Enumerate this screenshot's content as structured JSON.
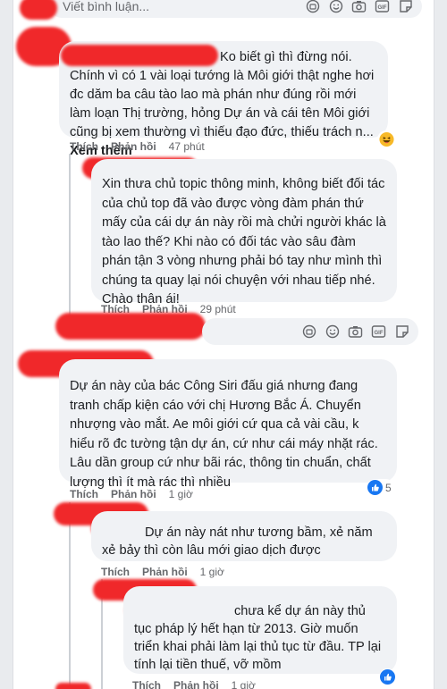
{
  "input_bar": {
    "placeholder": "Viết bình luận..."
  },
  "comments": [
    {
      "text": "Ko biết gì thì đừng nói. Chính vì có 1 vài loại tướng là Môi giới thật nghe hơi đc dăm ba câu tào lao mà phán như đúng rồi mới làm loạn Thị trường, hỏng Dự án và cái tên Môi giới cũng bị xem thường vì thiếu đạo đức, thiếu trách n... ",
      "see_more": "Xem thêm",
      "like": "Thích",
      "reply": "Phản hồi",
      "time": "47 phút",
      "reaction": "haha"
    },
    {
      "text": "Xin thưa chủ topic thông minh, không biết đối tác của chủ top đã vào được vòng đàm phán thứ mấy của cái dự án này rồi mà chửi người khác là tào lao thế? Khi nào có đối tác vào sâu đàm phán tận 3 vòng nhưng phải bó tay như mình thì chúng ta quay lại nói chuyện với nhau tiếp nhé. Chào thân ái!",
      "like": "Thích",
      "reply": "Phản hồi",
      "time": "29 phút"
    },
    {
      "text": "Dự án này của bác Công Siri đấu giá nhưng đang tranh chấp kiện cáo với chị Hương Bắc Á. Chuyển nhượng vào mắt. Ae môi giới cứ qua cả vài cầu, k hiểu rõ đc tường tận dự án, cứ như cái máy nhặt rác. Lâu dần group cứ như bãi rác, thông tin chuẩn, chất lượng thì ít mà rác thì nhiều",
      "like": "Thích",
      "reply": "Phản hồi",
      "time": "1 giờ",
      "reaction": "like",
      "reaction_count": "5"
    },
    {
      "text": "Dự án này nát như tương bầm, xẻ năm xẻ bảy thì còn lâu mới giao dịch được",
      "like": "Thích",
      "reply": "Phản hồi",
      "time": "1 giờ"
    },
    {
      "text": "chưa kể dự án này thủ tục pháp lý hết hạn từ 2013. Giờ muốn triển khai phải làm lại thủ tục từ đầu. TP lại tính lại tiền thuế, vỡ mồm",
      "like": "Thích",
      "reply": "Phản hồi",
      "time": "1 giờ",
      "reaction": "like"
    }
  ],
  "colors": {
    "like_blue": "#1877f2",
    "redaction": "#f0282a",
    "haha_yellow": "#f7b928"
  }
}
